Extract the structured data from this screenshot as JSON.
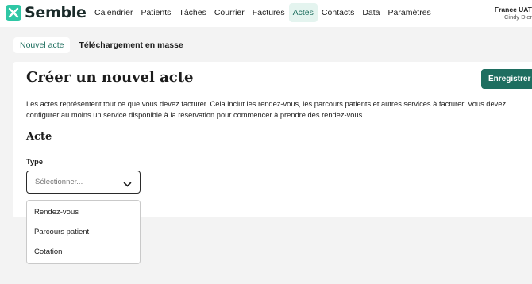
{
  "app": {
    "name": "Semble"
  },
  "nav": {
    "items": [
      {
        "label": "Calendrier"
      },
      {
        "label": "Patients"
      },
      {
        "label": "Tâches"
      },
      {
        "label": "Courrier"
      },
      {
        "label": "Factures"
      },
      {
        "label": "Actes",
        "active": true
      },
      {
        "label": "Contacts"
      },
      {
        "label": "Data"
      },
      {
        "label": "Paramètres"
      }
    ]
  },
  "account": {
    "org": "France UAT",
    "user": "Cindy Dier"
  },
  "tabs": [
    {
      "label": "Nouvel acte",
      "active": true
    },
    {
      "label": "Téléchargement en masse"
    }
  ],
  "page": {
    "title": "Créer un nouvel acte",
    "save_label": "Enregistrer",
    "description": "Les actes représentent tout ce que vous devez facturer. Cela inclut les rendez-vous, les parcours patients et autres services à facturer. Vous devez configurer au moins un service disponible à la réservation pour commencer à prendre des rendez-vous.",
    "section_title": "Acte",
    "type_label": "Type",
    "type_placeholder": "Sélectionner..."
  },
  "dropdown": {
    "options": [
      {
        "label": "Rendez-vous"
      },
      {
        "label": "Parcours patient"
      },
      {
        "label": "Cotation"
      }
    ]
  },
  "colors": {
    "brand": "#2fc7a5",
    "primary": "#1e6e60",
    "active_nav_bg": "#e4f4ef"
  },
  "icons": {
    "logo": "semble-logo-icon",
    "select_chevron": "chevron-down-icon"
  }
}
